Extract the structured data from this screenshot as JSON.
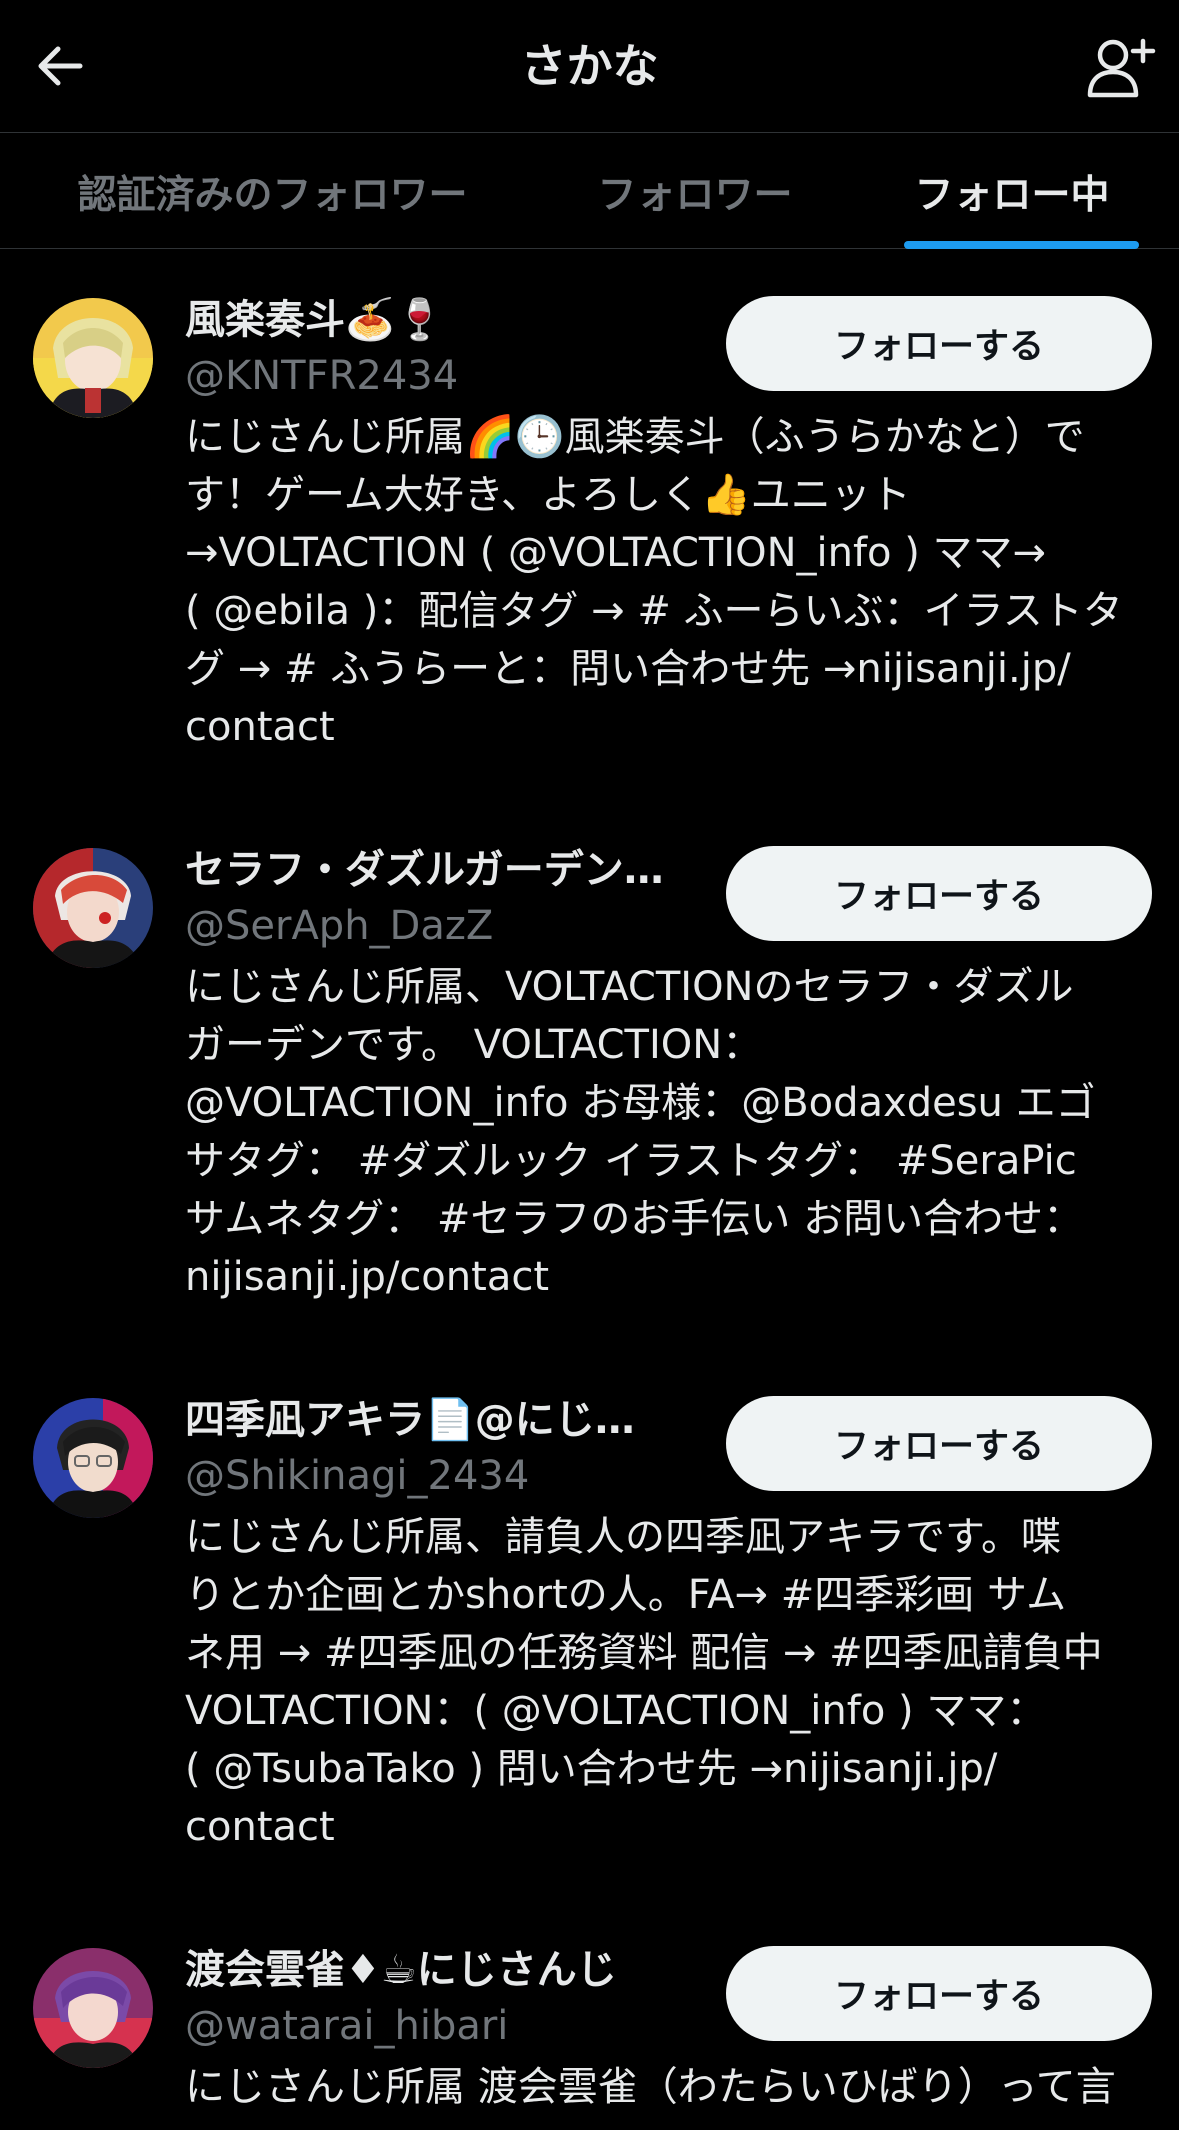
{
  "header": {
    "title": "さかな",
    "back_icon": "arrow-left-icon",
    "add_icon": "add-user-icon"
  },
  "tabs": [
    {
      "label": "認証済みのフォロワー",
      "active": false
    },
    {
      "label": "フォロワー",
      "active": false
    },
    {
      "label": "フォロー中",
      "active": true
    }
  ],
  "accent_color": "#1d9bf0",
  "users": [
    {
      "name": "風楽奏斗🍝🍷",
      "handle": "@KNTFR2434",
      "follow_label": "フォローする",
      "bio": "にじさんじ所属🌈🕒風楽奏斗（ふうらかなと）で\nす！ゲーム大好き、よろしく👍ユニット\n→VOLTACTION ( @VOLTACTION_info ) ママ→\n( @ebila )：配信タグ → # ふーらいぶ：イラストタ\nグ → # ふうらーと：問い合わせ先 →nijisanji.jp/\ncontact"
    },
    {
      "name": "セラフ・ダズルガーデン…",
      "handle": "@SerAph_DazZ",
      "follow_label": "フォローする",
      "bio": "にじさんじ所属、VOLTACTIONのセラフ・ダズル\nガーデンです。 VOLTACTION：\n@VOLTACTION_info お母様：@Bodaxdesu エゴ\nサタグ： #ダズルック イラストタグ： #SeraPic\nサムネタグ： #セラフのお手伝い お問い合わせ：\nnijisanji.jp/contact"
    },
    {
      "name": "四季凪アキラ📄@にじ…",
      "handle": "@Shikinagi_2434",
      "follow_label": "フォローする",
      "bio": "にじさんじ所属、請負人の四季凪アキラです。喋\nりとか企画とかshortの人。FA→ #四季彩画 サム\nネ用 → #四季凪の任務資料 配信 → #四季凪請負中\nVOLTACTION：( @VOLTACTION_info ) ママ：\n( @TsubaTako ) 問い合わせ先 →nijisanji.jp/\ncontact"
    },
    {
      "name": "渡会雲雀♦☕にじさんじ",
      "handle": "@watarai_hibari",
      "follow_label": "フォローする",
      "bio": "にじさんじ所属 渡会雲雀（わたらいひばり）って言"
    }
  ]
}
